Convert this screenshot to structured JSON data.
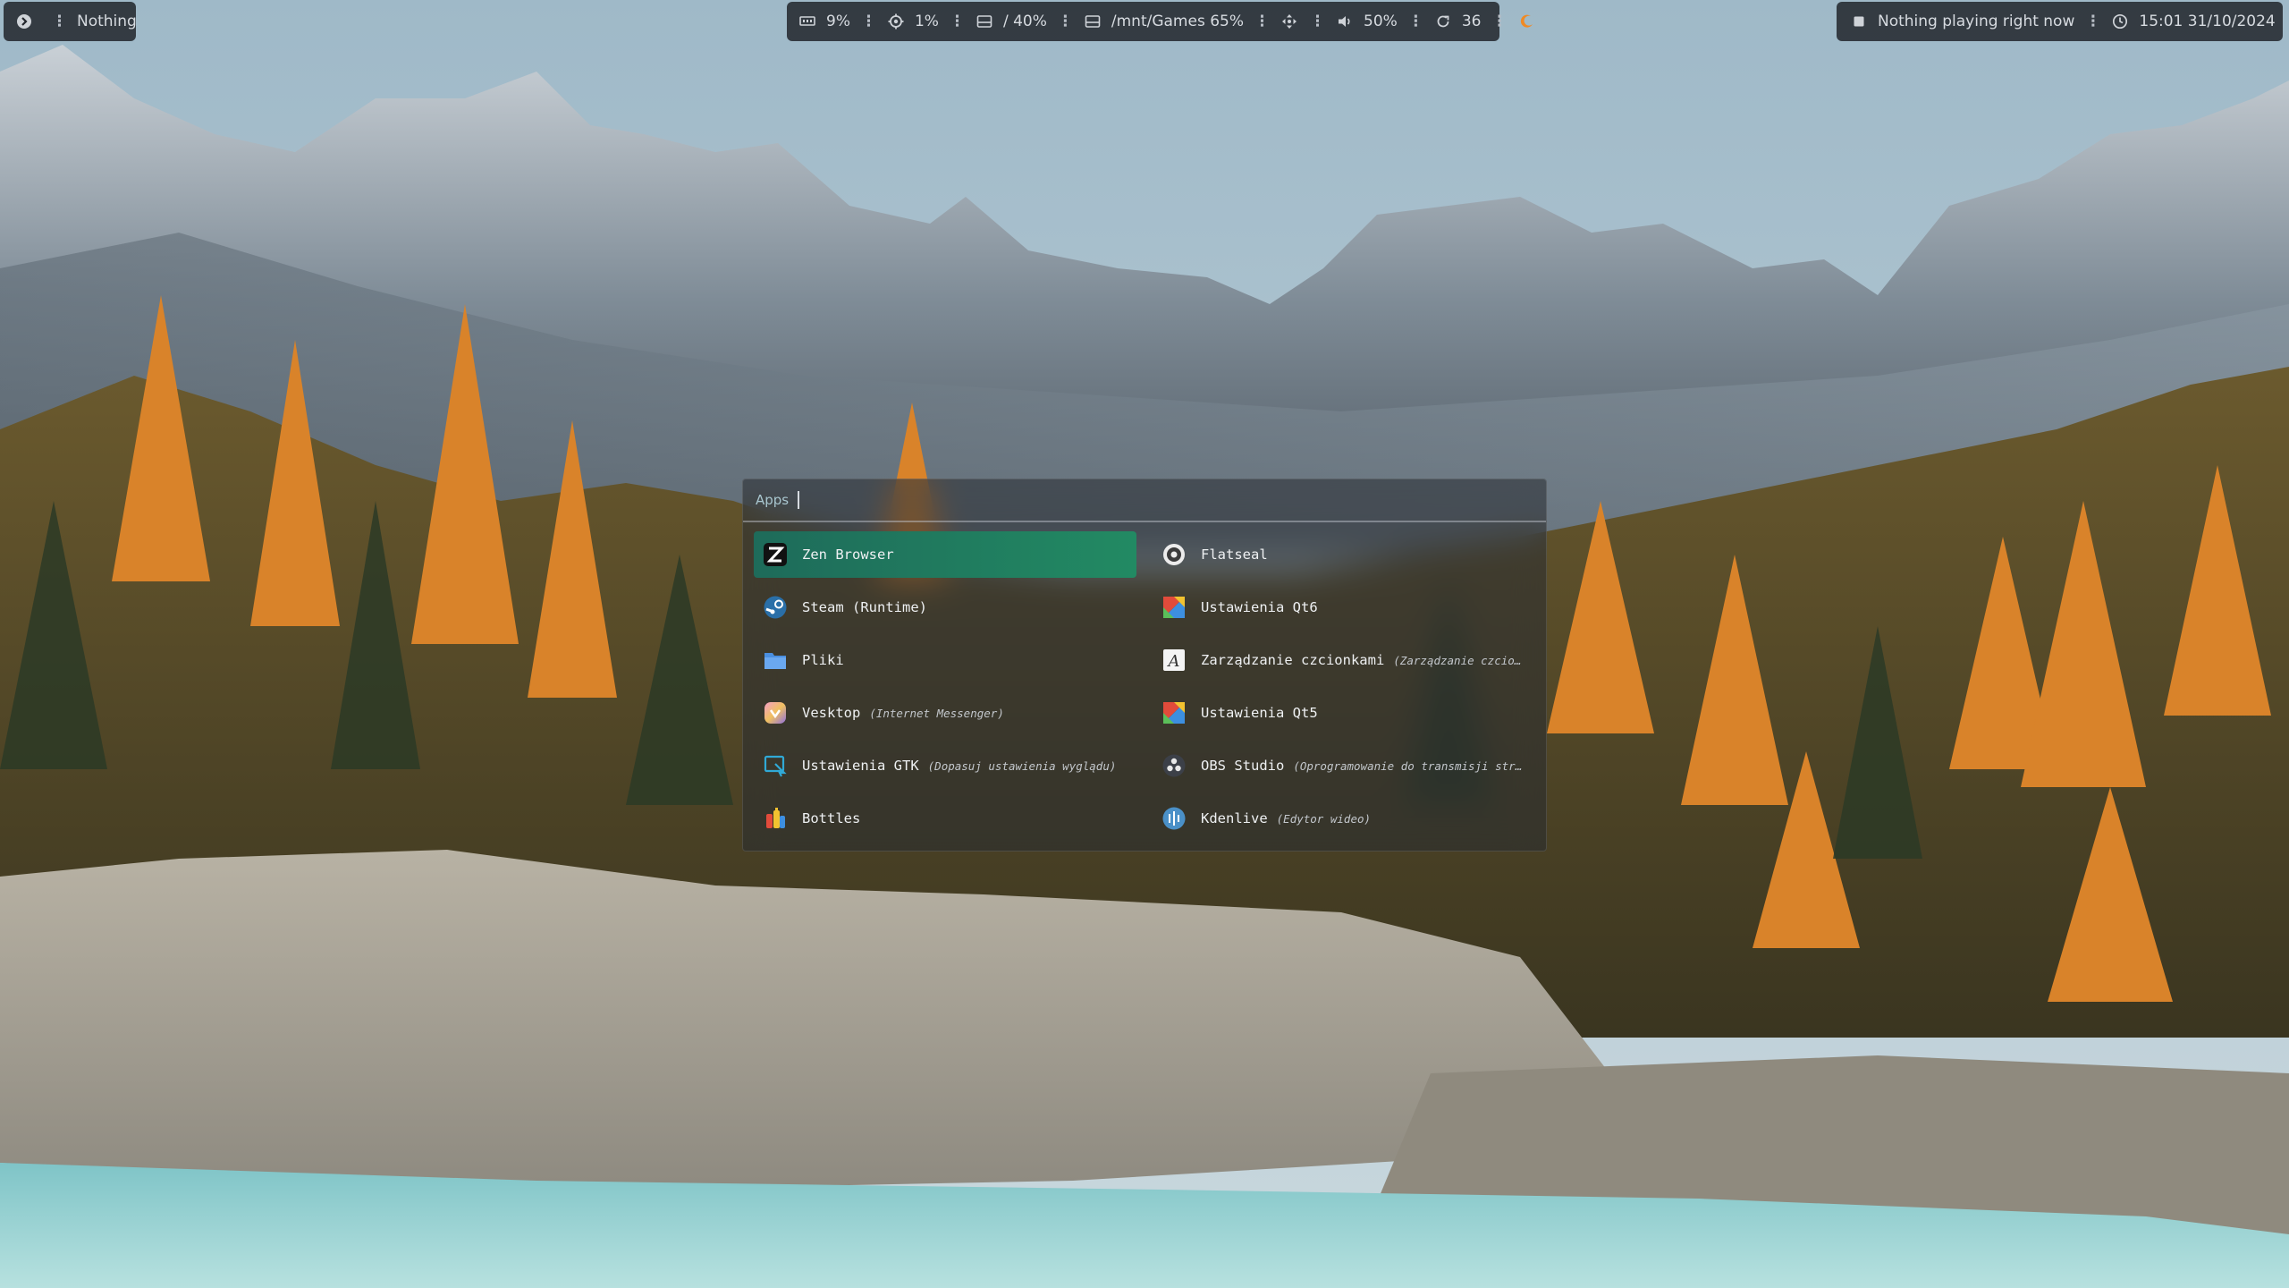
{
  "topbar": {
    "left": {
      "workspace_icon": "workspace-icon",
      "label": "Nothing"
    },
    "center": {
      "ram": {
        "icon": "memory-icon",
        "value": "9%"
      },
      "cpu": {
        "icon": "cpu-icon",
        "value": "1%"
      },
      "disk_root": {
        "icon": "disk-icon",
        "value": "/ 40%"
      },
      "disk_games": {
        "icon": "disk-icon",
        "value": "/mnt/Games 65%"
      },
      "misc_icon": "move-icon",
      "volume": {
        "icon": "volume-icon",
        "value": "50%"
      },
      "updates": {
        "icon": "refresh-icon",
        "value": "36"
      },
      "night_icon": "moon-icon"
    },
    "right": {
      "media_icon": "stop-icon",
      "media_text": "Nothing playing right now",
      "clock_icon": "clock-icon",
      "datetime": "15:01 31/10/2024"
    }
  },
  "launcher": {
    "prompt": "Apps",
    "query": "",
    "apps": [
      {
        "name": "Zen Browser",
        "description": "",
        "icon": "zen-browser-icon",
        "selected": true
      },
      {
        "name": "Flatseal",
        "description": "",
        "icon": "flatseal-icon",
        "selected": false
      },
      {
        "name": "Steam (Runtime)",
        "description": "",
        "icon": "steam-icon",
        "selected": false
      },
      {
        "name": "Ustawienia Qt6",
        "description": "",
        "icon": "qt-settings-icon",
        "selected": false
      },
      {
        "name": "Pliki",
        "description": "",
        "icon": "folder-icon",
        "selected": false
      },
      {
        "name": "Zarządzanie czcionkami",
        "description": "(Zarządzanie czcionkam…",
        "icon": "font-manager-icon",
        "selected": false
      },
      {
        "name": "Vesktop",
        "description": "(Internet Messenger)",
        "icon": "vesktop-icon",
        "selected": false
      },
      {
        "name": "Ustawienia Qt5",
        "description": "",
        "icon": "qt-settings-icon",
        "selected": false
      },
      {
        "name": "Ustawienia GTK",
        "description": "(Dopasuj ustawienia wyglądu)",
        "icon": "gtk-settings-icon",
        "selected": false
      },
      {
        "name": "OBS Studio",
        "description": "(Oprogramowanie do transmisji strumie…",
        "icon": "obs-icon",
        "selected": false
      },
      {
        "name": "Bottles",
        "description": "",
        "icon": "bottles-icon",
        "selected": false
      },
      {
        "name": "Kdenlive",
        "description": "(Edytor wideo)",
        "icon": "kdenlive-icon",
        "selected": false
      }
    ]
  },
  "colors": {
    "bar_bg": "#22262c",
    "selected_accent": "#228a63",
    "prompt_text": "#a9c6cf"
  }
}
